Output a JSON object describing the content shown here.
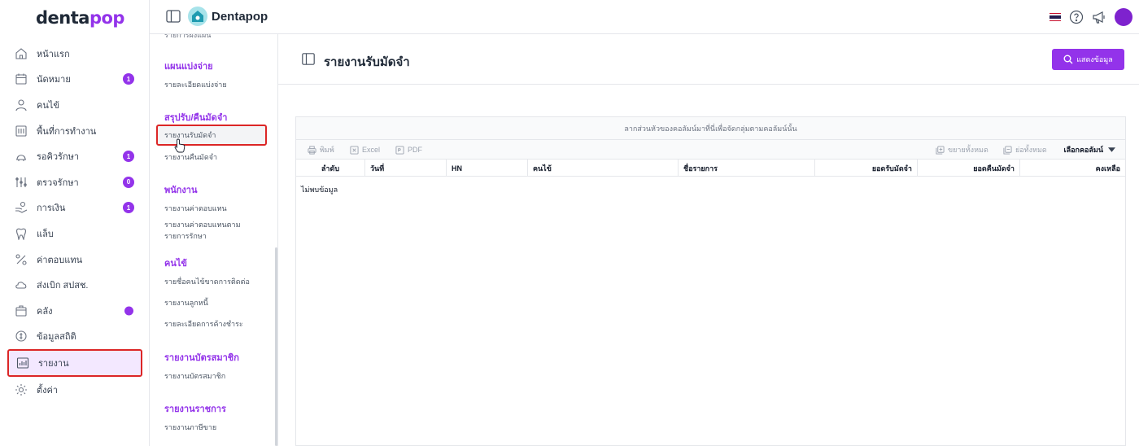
{
  "brand": {
    "logo_part1": "denta",
    "logo_part2": "pop",
    "accent": "#9333ea",
    "active_outline": "#dc2626"
  },
  "sidebar": {
    "items": [
      {
        "label": "หน้าแรก",
        "icon": "home-icon"
      },
      {
        "label": "นัดหมาย",
        "icon": "calendar-icon",
        "badge": "1"
      },
      {
        "label": "คนไข้",
        "icon": "user-icon"
      },
      {
        "label": "พื้นที่การทำงาน",
        "icon": "workspace-icon"
      },
      {
        "label": "รอคิวรักษา",
        "icon": "dental-chair-icon",
        "badge": "1"
      },
      {
        "label": "ตรวจรักษา",
        "icon": "tools-icon",
        "badge": "0"
      },
      {
        "label": "การเงิน",
        "icon": "hand-coin-icon",
        "badge": "1"
      },
      {
        "label": "แล็บ",
        "icon": "tooth-icon"
      },
      {
        "label": "ค่าตอบแทน",
        "icon": "percent-icon"
      },
      {
        "label": "ส่งเบิก สปสช.",
        "icon": "cloud-icon"
      },
      {
        "label": "คลัง",
        "icon": "box-icon",
        "dot": true
      },
      {
        "label": "ข้อมูลสถิติ",
        "icon": "coin-icon"
      },
      {
        "label": "รายงาน",
        "icon": "report-chart-icon",
        "active": true
      },
      {
        "label": "ตั้งค่า",
        "icon": "gear-icon"
      }
    ]
  },
  "topbar": {
    "clinic_name": "Dentapop",
    "icons": [
      "thai-flag-icon",
      "help-icon",
      "megaphone-icon",
      "avatar"
    ]
  },
  "submenu": {
    "cut_text": "รายการผังแผน",
    "sections": [
      {
        "title": "แผนแบ่งจ่าย",
        "links": [
          "รายละเอียดแบ่งจ่าย"
        ]
      },
      {
        "title": "สรุปรับ/คืนมัดจำ",
        "links": [
          "รายงานรับมัดจำ",
          "รายงานคืนมัดจำ"
        ]
      },
      {
        "title": "พนักงาน",
        "links": [
          "รายงานค่าตอบแทน",
          "รายงานค่าตอบแทนตาม รายการรักษา"
        ]
      },
      {
        "title": "คนไข้",
        "links": [
          "รายชื่อคนไข้ขาดการติดต่อ",
          "รายงานลูกหนี้",
          "รายละเอียดการค้างชำระ"
        ]
      },
      {
        "title": "รายงานบัตรสมาชิก",
        "links": [
          "รายงานบัตรสมาชิก"
        ]
      },
      {
        "title": "รายงานราชการ",
        "links": [
          "รายงานภาษีขาย"
        ]
      }
    ]
  },
  "page": {
    "title": "รายงานรับมัดจำ",
    "show_button": "แสดงข้อมูล"
  },
  "grid": {
    "group_panel": "ลากส่วนหัวของคอลัมน์มาที่นี่เพื่อจัดกลุ่มตามคอลัมน์นั้น",
    "toolbar": {
      "print": "พิมพ์",
      "excel": "Excel",
      "pdf": "PDF",
      "expand_all": "ขยายทั้งหมด",
      "collapse_all": "ย่อทั้งหมด",
      "column_chooser": "เลือกคอลัมน์"
    },
    "columns": [
      "ลำดับ",
      "วันที่",
      "HN",
      "คนไข้",
      "ชื่อรายการ",
      "ยอดรับมัดจำ",
      "ยอดคืนมัดจำ",
      "คงเหลือ"
    ],
    "empty_text": "ไม่พบข้อมูล"
  }
}
